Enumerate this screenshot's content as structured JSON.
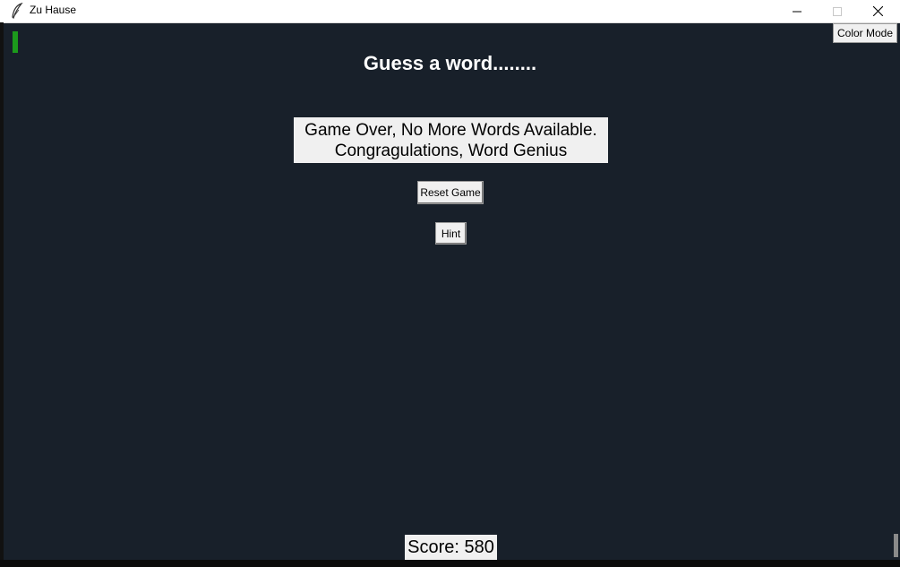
{
  "window": {
    "title": "Zu Hause",
    "icon": "feather-icon",
    "controls": [
      "minimize-icon",
      "maximize-icon",
      "close-icon"
    ]
  },
  "toolbar": {
    "color_mode_label": "Color Mode"
  },
  "game": {
    "heading": "Guess a word........",
    "message_line1": "Game Over, No More Words Available.",
    "message_line2": "Congragulations, Word Genius",
    "reset_label": "Reset Game",
    "hint_label": "Hint",
    "score_text": "Score: 580"
  },
  "colors": {
    "background": "#18202a",
    "heading_text": "#ffffff",
    "button_bg": "#f0f0f0",
    "cursor_accent": "#1c9a1c"
  }
}
